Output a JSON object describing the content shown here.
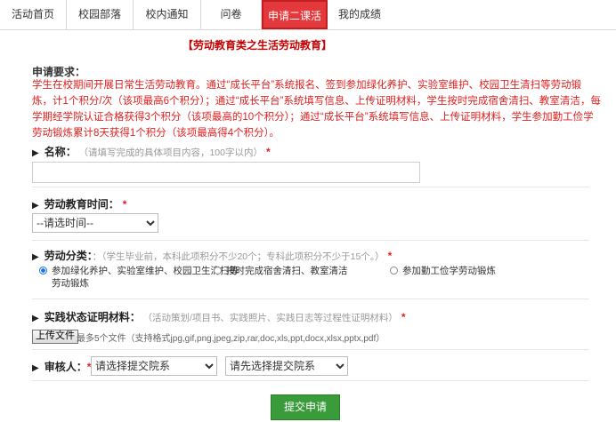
{
  "tabs": [
    {
      "label": "活动首页"
    },
    {
      "label": "校园部落"
    },
    {
      "label": "校内通知"
    },
    {
      "label": "问卷"
    },
    {
      "label": "申请二课活动积"
    },
    {
      "label": "我的成绩"
    }
  ],
  "page_title": "【劳动教育类之生活劳动教育】",
  "requirements": {
    "heading": "申请要求：",
    "body": "学生在校期间开展日常生活劳动教育。通过“成长平台”系统报名、签到参加绿化养护、实验室维护、校园卫生清扫等劳动锻炼，计1个积分/次（该项最高6个积分）；通过“成长平台”系统填写信息、上传证明材料，学生按时完成宿舍清扫、教室清洁，每学期经学院认证合格获得3个积分（该项最高的10个积分）；通过“成长平台”系统填写信息、上传证明材料，学生参加勤工俭学劳动锻炼累计8天获得1个积分（该项最高得4个积分）。"
  },
  "fields": {
    "name": {
      "label": "名称：",
      "hint": "（请填写完成的具体项目内容，100字以内）",
      "required": "*",
      "value": ""
    },
    "time": {
      "label": "劳动教育时间：",
      "required": "*",
      "selected": "--请选时间--"
    },
    "category": {
      "label": "劳动分类：",
      "hint": "：（学生毕业前，本科此项积分不少20个；专科此项积分不少于15个。）",
      "required": "*",
      "options": [
        {
          "label_line1": "参加绿化养护、实验室维护、校园卫生清扫等",
          "label_line2": "劳动锻炼",
          "selected": true
        },
        {
          "label_line1": "按时完成宿舍清扫、教室清洁",
          "selected": false
        },
        {
          "label_line1": "参加勤工俭学劳动锻炼",
          "selected": false
        }
      ]
    },
    "proof": {
      "label": "实践状态证明材料：",
      "hint": "（活动策划/项目书、实践照片、实践日志等过程性证明材料）",
      "required": "*",
      "upload_label": "上传文件",
      "upload_hint": "最多5个文件（支持格式jpg,gif,png,jpeg,zip,rar,doc,xls,ppt,docx,xlsx,pptx,pdf）"
    },
    "reviewer": {
      "label": "审核人：",
      "required": "*",
      "college_selected": "请选择提交院系",
      "person_selected": "请先选择提交院系"
    }
  },
  "submit_label": "提交申请",
  "colors": {
    "accent_red": "#e4393c",
    "required_red": "#e02020",
    "submit_green": "#3a9b3a"
  }
}
